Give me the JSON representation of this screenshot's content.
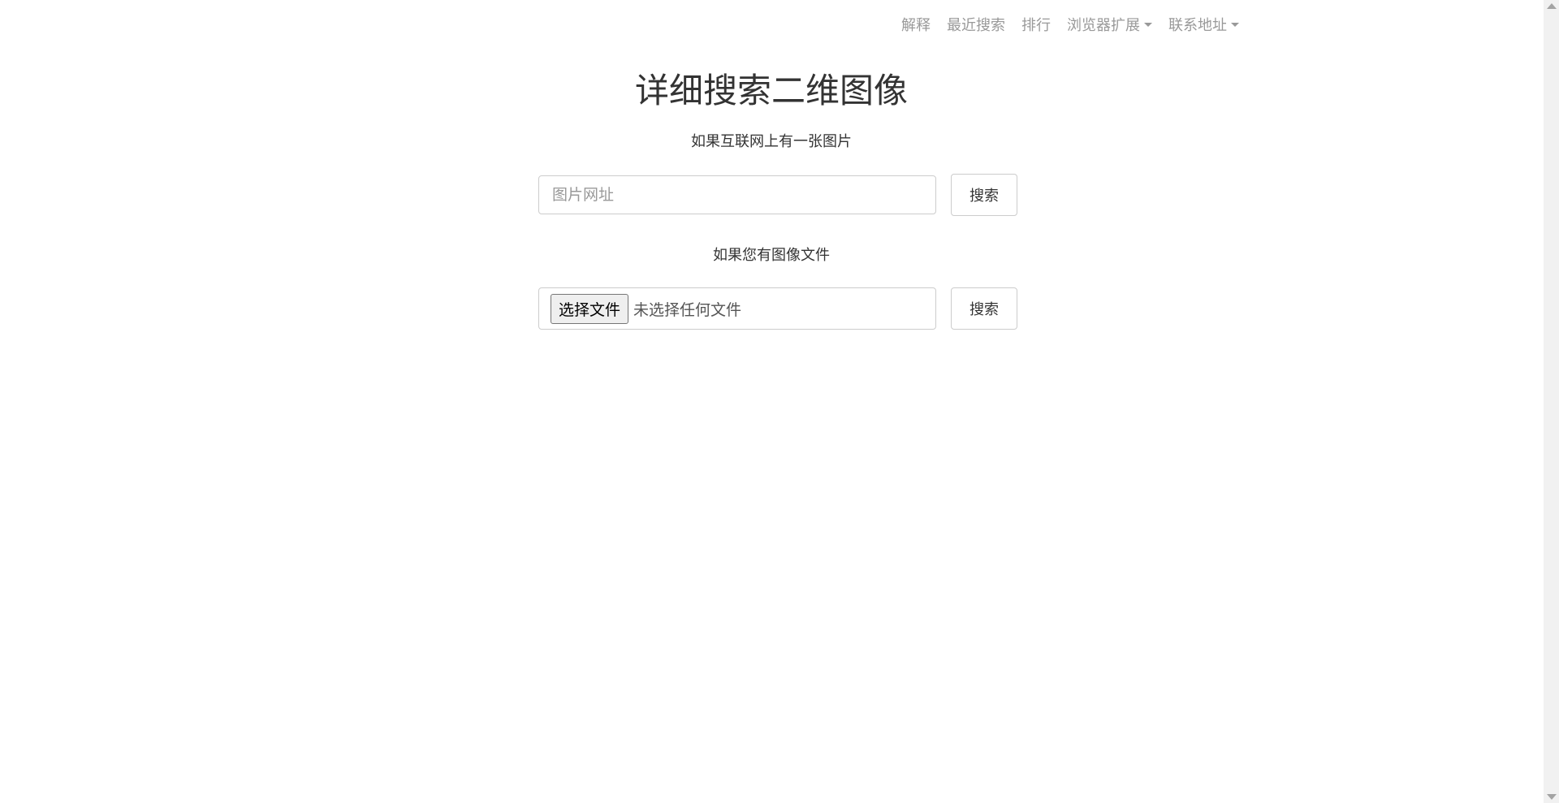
{
  "nav": {
    "explain": "解释",
    "recent_search": "最近搜索",
    "ranking": "排行",
    "browser_ext": "浏览器扩展",
    "contact": "联系地址"
  },
  "main": {
    "title": "详细搜索二维图像",
    "url_section_label": "如果互联网上有一张图片",
    "url_placeholder": "图片网址",
    "url_search_label": "搜索",
    "file_section_label": "如果您有图像文件",
    "file_choose_label": "选择文件",
    "file_status": "未选择任何文件",
    "file_search_label": "搜索"
  }
}
